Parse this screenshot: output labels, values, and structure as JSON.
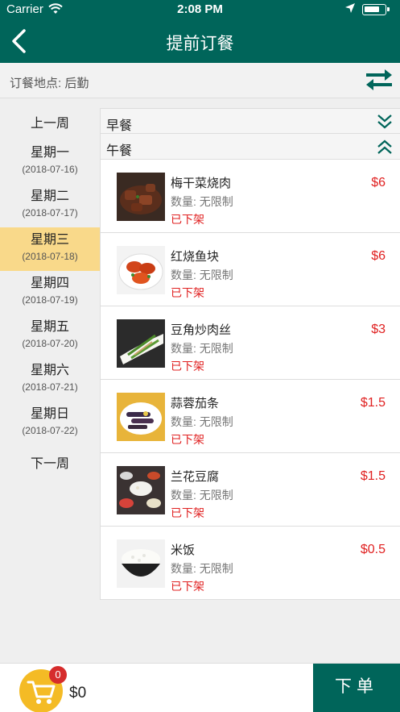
{
  "status_bar": {
    "carrier": "Carrier",
    "time": "2:08 PM",
    "battery_level": 0.75
  },
  "nav": {
    "title": "提前订餐",
    "back_icon": "chevron-left-icon"
  },
  "location": {
    "text": "订餐地点: 后勤",
    "swap_icon": "swap-arrows-icon"
  },
  "sidebar": {
    "prev_week": "上一周",
    "next_week": "下一周",
    "days": [
      {
        "name": "星期一",
        "date": "(2018-07-16)"
      },
      {
        "name": "星期二",
        "date": "(2018-07-17)"
      },
      {
        "name": "星期三",
        "date": "(2018-07-18)"
      },
      {
        "name": "星期四",
        "date": "(2018-07-19)"
      },
      {
        "name": "星期五",
        "date": "(2018-07-20)"
      },
      {
        "name": "星期六",
        "date": "(2018-07-21)"
      },
      {
        "name": "星期日",
        "date": "(2018-07-22)"
      }
    ],
    "selected_index": 2
  },
  "meals": {
    "breakfast": {
      "title": "早餐",
      "expanded": false
    },
    "lunch": {
      "title": "午餐",
      "expanded": true
    }
  },
  "dishes": [
    {
      "name": "梅干菜烧肉",
      "qty": "数量: 无限制",
      "status": "已下架",
      "price": "$6"
    },
    {
      "name": "红烧鱼块",
      "qty": "数量: 无限制",
      "status": "已下架",
      "price": "$6"
    },
    {
      "name": "豆角炒肉丝",
      "qty": "数量: 无限制",
      "status": "已下架",
      "price": "$3"
    },
    {
      "name": "蒜蓉茄条",
      "qty": "数量: 无限制",
      "status": "已下架",
      "price": "$1.5"
    },
    {
      "name": "兰花豆腐",
      "qty": "数量: 无限制",
      "status": "已下架",
      "price": "$1.5"
    },
    {
      "name": "米饭",
      "qty": "数量: 无限制",
      "status": "已下架",
      "price": "$0.5"
    }
  ],
  "cart": {
    "count": "0",
    "total": "$0",
    "icon": "cart-icon"
  },
  "order_button": "下单",
  "colors": {
    "primary": "#00655a",
    "selected_day": "#f9d98a",
    "price_red": "#e02020",
    "cart_yellow": "#f4bb25",
    "badge_red": "#d62c2c"
  }
}
